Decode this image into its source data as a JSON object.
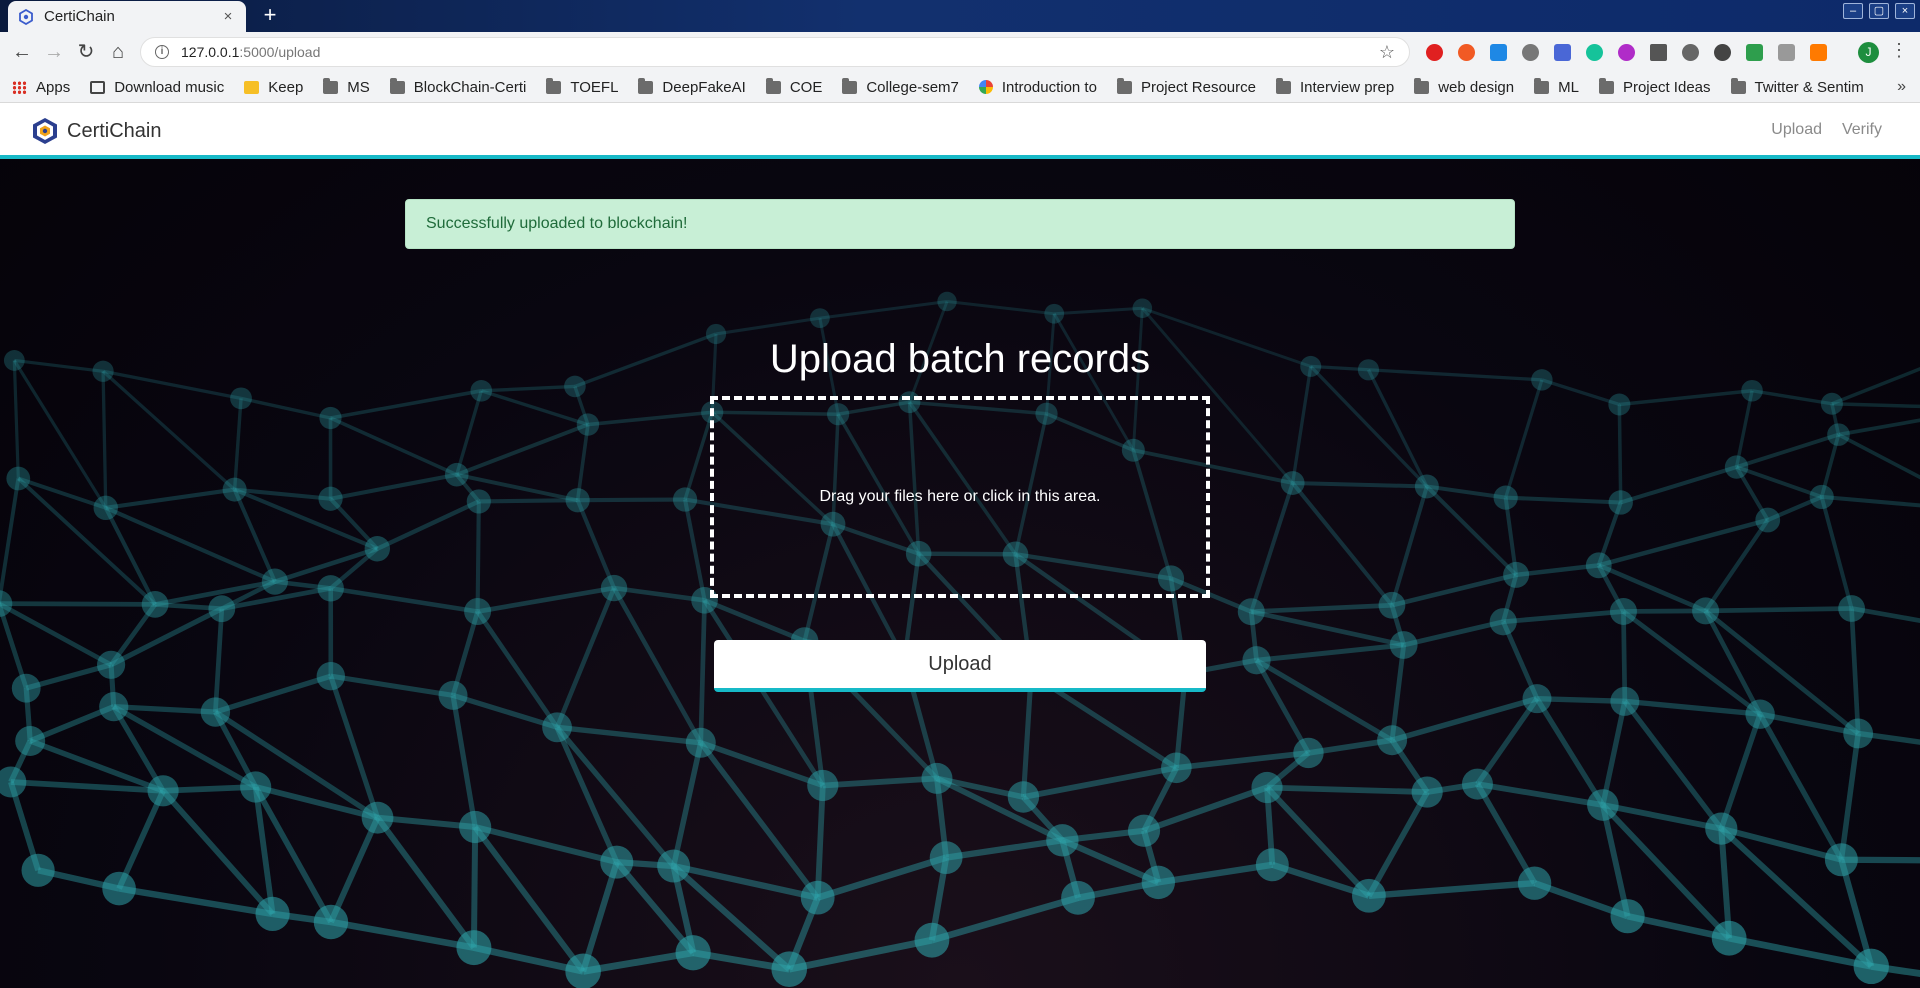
{
  "browser": {
    "tab_title": "CertiChain",
    "tab_close": "×",
    "new_tab": "+",
    "window_controls": [
      "–",
      "▢",
      "×"
    ],
    "url_host": "127.0.0.1",
    "url_path": ":5000/upload",
    "avatar_initial": "J",
    "bookmarks": [
      {
        "label": "Apps",
        "icon": "apps-grid-icon"
      },
      {
        "label": "Download music",
        "icon": "image-icon"
      },
      {
        "label": "Keep",
        "icon": "keep-icon"
      },
      {
        "label": "MS",
        "icon": "folder-icon"
      },
      {
        "label": "BlockChain-Certi",
        "icon": "folder-icon"
      },
      {
        "label": "TOEFL",
        "icon": "folder-icon"
      },
      {
        "label": "DeepFakeAI",
        "icon": "folder-icon"
      },
      {
        "label": "COE",
        "icon": "folder-icon"
      },
      {
        "label": "College-sem7",
        "icon": "folder-icon"
      },
      {
        "label": "Introduction to",
        "icon": "google-icon"
      },
      {
        "label": "Project Resource",
        "icon": "folder-icon"
      },
      {
        "label": "Interview prep",
        "icon": "folder-icon"
      },
      {
        "label": "web design",
        "icon": "folder-icon"
      },
      {
        "label": "ML",
        "icon": "folder-icon"
      },
      {
        "label": "Project Ideas",
        "icon": "folder-icon"
      },
      {
        "label": "Twitter & Sentim",
        "icon": "folder-icon"
      }
    ],
    "bookmarks_more": "»"
  },
  "app": {
    "brand": "CertiChain",
    "nav": {
      "upload": "Upload",
      "verify": "Verify"
    },
    "alert": "Successfully uploaded to blockchain!",
    "heading": "Upload batch records",
    "dropzone_text": "Drag your files here or click in this area.",
    "upload_button": "Upload"
  },
  "colors": {
    "accent": "#17b9c7",
    "alert_bg": "#c8efd6",
    "alert_text": "#1f6b3a",
    "page_bg": "#090610",
    "network": "#2fa7ad"
  }
}
